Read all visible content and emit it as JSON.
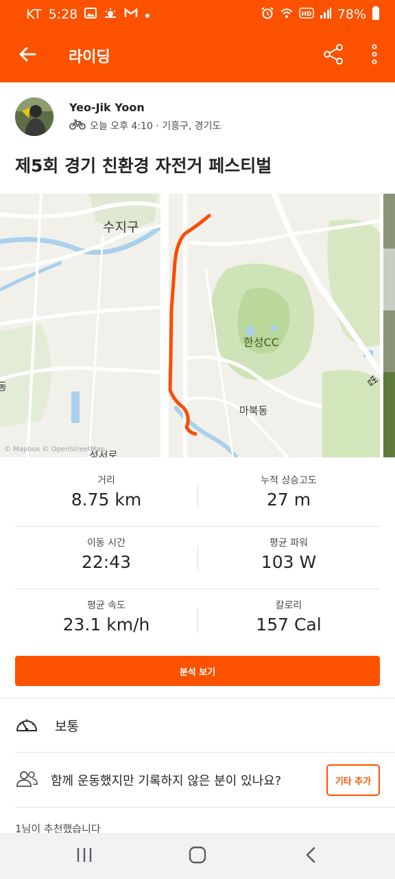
{
  "status_bar": {
    "carrier": "KT",
    "time": "5:28",
    "battery": "78%",
    "notification_icons": [
      "gallery-icon",
      "weather-icon",
      "gmail-icon",
      "dot-icon"
    ],
    "system_icons": [
      "alarm-icon",
      "wifi-icon",
      "hd-icon",
      "signal-icon",
      "battery-icon"
    ]
  },
  "app_bar": {
    "title": "라이딩",
    "back_icon": "arrow-left-icon",
    "share_icon": "share-icon",
    "more_icon": "more-vertical-icon"
  },
  "athlete": {
    "name": "Yeo-Jik Yoon",
    "activity_icon": "bicycle-icon",
    "meta": "오늘 오후 4:10 · 기흥구, 경기도"
  },
  "activity": {
    "title": "제5회 경기 친환경 자전거 페스티벌"
  },
  "map": {
    "labels": {
      "suji": "수지구",
      "hanseong": "한성CC",
      "mabuk": "마북동",
      "edge_left": "동",
      "edge_right": "법",
      "bottom": "성서로"
    },
    "attribution": "© Mapbox © OpenStreetMap",
    "route_color": "#fc4c02"
  },
  "stats": [
    {
      "label": "거리",
      "value": "8.75 km"
    },
    {
      "label": "누적 상승고도",
      "value": "27 m"
    },
    {
      "label": "이동 시간",
      "value": "22:43"
    },
    {
      "label": "평균 파워",
      "value": "103 W"
    },
    {
      "label": "평균 속도",
      "value": "23.1 km/h"
    },
    {
      "label": "칼로리",
      "value": "157 Cal"
    }
  ],
  "analysis_button": "분석 보기",
  "effort": {
    "icon": "gauge-icon",
    "label": "보통"
  },
  "group": {
    "icon": "people-icon",
    "label": "함께 운동했지만 기록하지 않은 분이 있나요?",
    "button": "기타 추가"
  },
  "kudos": "1님이 추천했습니다",
  "nav_bar": {
    "icons": [
      "recent-apps-icon",
      "home-icon",
      "back-icon"
    ]
  },
  "colors": {
    "brand": "#fc5200",
    "text": "#242428",
    "secondary_text": "#494950"
  }
}
